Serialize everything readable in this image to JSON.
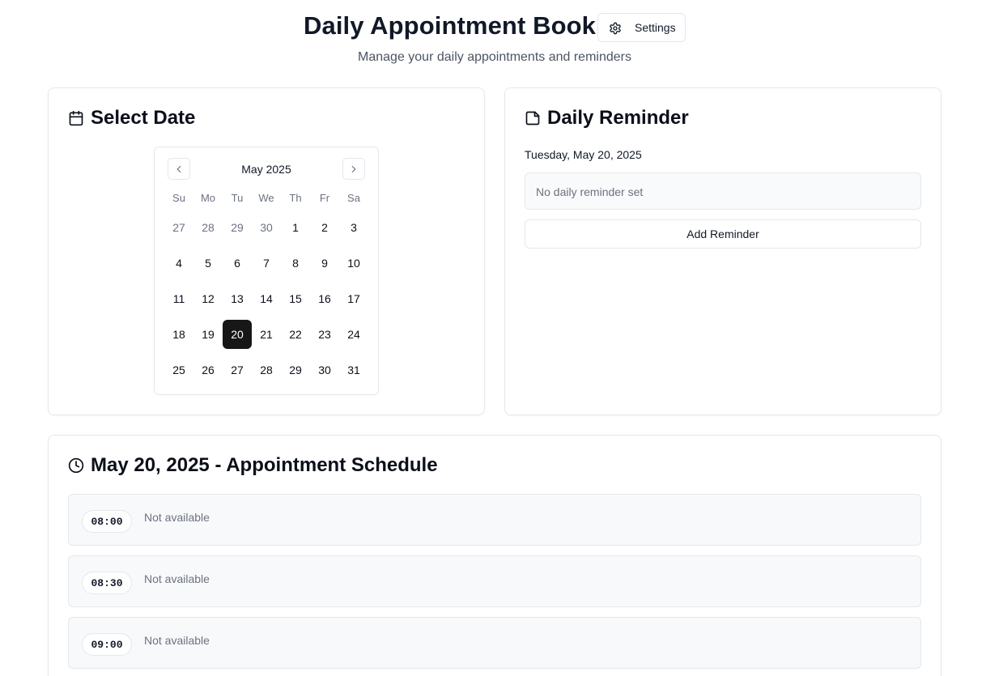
{
  "header": {
    "title": "Daily Appointment Book",
    "settings_label": "Settings",
    "subtitle": "Manage your daily appointments and reminders"
  },
  "date_card": {
    "title": "Select Date",
    "calendar": {
      "month_label": "May 2025",
      "weekdays": [
        "Su",
        "Mo",
        "Tu",
        "We",
        "Th",
        "Fr",
        "Sa"
      ],
      "weeks": [
        [
          {
            "day": "27",
            "outside": true
          },
          {
            "day": "28",
            "outside": true
          },
          {
            "day": "29",
            "outside": true
          },
          {
            "day": "30",
            "outside": true
          },
          {
            "day": "1"
          },
          {
            "day": "2"
          },
          {
            "day": "3"
          }
        ],
        [
          {
            "day": "4"
          },
          {
            "day": "5"
          },
          {
            "day": "6"
          },
          {
            "day": "7"
          },
          {
            "day": "8"
          },
          {
            "day": "9"
          },
          {
            "day": "10"
          }
        ],
        [
          {
            "day": "11"
          },
          {
            "day": "12"
          },
          {
            "day": "13"
          },
          {
            "day": "14"
          },
          {
            "day": "15"
          },
          {
            "day": "16"
          },
          {
            "day": "17"
          }
        ],
        [
          {
            "day": "18"
          },
          {
            "day": "19"
          },
          {
            "day": "20",
            "selected": true
          },
          {
            "day": "21"
          },
          {
            "day": "22"
          },
          {
            "day": "23"
          },
          {
            "day": "24"
          }
        ],
        [
          {
            "day": "25"
          },
          {
            "day": "26"
          },
          {
            "day": "27"
          },
          {
            "day": "28"
          },
          {
            "day": "29"
          },
          {
            "day": "30"
          },
          {
            "day": "31"
          }
        ]
      ]
    }
  },
  "reminder_card": {
    "title": "Daily Reminder",
    "date_label": "Tuesday, May 20, 2025",
    "empty_text": "No daily reminder set",
    "add_button": "Add Reminder"
  },
  "schedule": {
    "title": "May 20, 2025 - Appointment Schedule",
    "slots": [
      {
        "time": "08:00",
        "status": "Not available"
      },
      {
        "time": "08:30",
        "status": "Not available"
      },
      {
        "time": "09:00",
        "status": "Not available"
      }
    ]
  },
  "colors": {
    "selected_day_bg": "#171717",
    "border": "#e5e7eb",
    "muted_text": "#6b7280",
    "slot_bg": "#f8f9fb"
  }
}
